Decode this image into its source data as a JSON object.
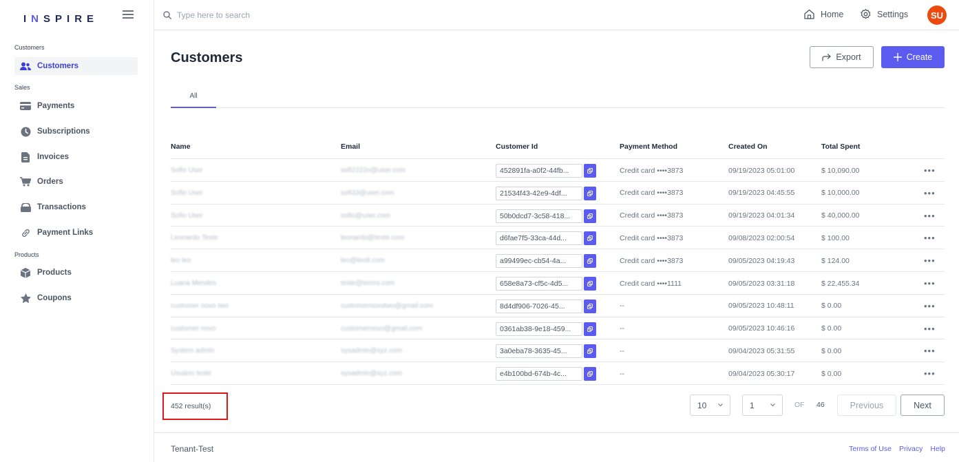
{
  "brand": {
    "prefix": "I",
    "accent": "N",
    "rest": "SPIRE"
  },
  "search": {
    "placeholder": "Type here to search"
  },
  "topnav": {
    "home": "Home",
    "settings": "Settings",
    "avatar": "SU"
  },
  "sidebar": {
    "sections": {
      "customers": "Customers",
      "sales": "Sales",
      "products": "Products"
    },
    "items": [
      {
        "label": "Customers",
        "icon": "users-icon",
        "active": true
      },
      {
        "label": "Payments",
        "icon": "credit-card-icon"
      },
      {
        "label": "Subscriptions",
        "icon": "clock-icon"
      },
      {
        "label": "Invoices",
        "icon": "document-icon"
      },
      {
        "label": "Orders",
        "icon": "cart-icon"
      },
      {
        "label": "Transactions",
        "icon": "stack-icon"
      },
      {
        "label": "Payment Links",
        "icon": "link-icon"
      },
      {
        "label": "Products",
        "icon": "box-icon"
      },
      {
        "label": "Coupons",
        "icon": "star-icon"
      }
    ]
  },
  "page": {
    "title": "Customers",
    "export_label": "Export",
    "create_label": "Create",
    "tab_all": "All"
  },
  "table": {
    "headers": [
      "Name",
      "Email",
      "Customer Id",
      "Payment Method",
      "Created On",
      "Total Spent"
    ],
    "rows": [
      {
        "name": "Sofio User",
        "email": "sofi2222o@user.com",
        "id": "452891fa-a0f2-44fb...",
        "method": "Credit card ••••3873",
        "created": "09/19/2023 05:01:00",
        "spent": "$ 10,090.00"
      },
      {
        "name": "Sofio User",
        "email": "sofi33@user.com",
        "id": "21534f43-42e9-4df...",
        "method": "Credit card ••••3873",
        "created": "09/19/2023 04:45:55",
        "spent": "$ 10,000.00"
      },
      {
        "name": "Sofio User",
        "email": "sofio@user.com",
        "id": "50b0dcd7-3c58-418...",
        "method": "Credit card ••••3873",
        "created": "09/19/2023 04:01:34",
        "spent": "$ 40,000.00"
      },
      {
        "name": "Leonardo Teste",
        "email": "leonardo@teste.com",
        "id": "d6fae7f5-33ca-44d...",
        "method": "Credit card ••••3873",
        "created": "09/08/2023 02:00:54",
        "spent": "$ 100.00"
      },
      {
        "name": "leo leo",
        "email": "leo@leo8.com",
        "id": "a99499ec-cb54-4a...",
        "method": "Credit card ••••3873",
        "created": "09/05/2023 04:19:43",
        "spent": "$ 124.00"
      },
      {
        "name": "Luana Mendes",
        "email": "teste@terms.com",
        "id": "658e8a73-cf5c-4d5...",
        "method": "Credit card ••••1111",
        "created": "09/05/2023 03:31:18",
        "spent": "$ 22,455.34"
      },
      {
        "name": "customer novo two",
        "email": "customernovotwo@gmail.com",
        "id": "8d4df906-7026-45...",
        "method": "--",
        "created": "09/05/2023 10:48:11",
        "spent": "$ 0.00"
      },
      {
        "name": "customer novo",
        "email": "customernovo@gmail.com",
        "id": "0361ab38-9e18-459...",
        "method": "--",
        "created": "09/05/2023 10:46:16",
        "spent": "$ 0.00"
      },
      {
        "name": "System admin",
        "email": "sysadmin@xyz.com",
        "id": "3a0eba78-3635-45...",
        "method": "--",
        "created": "09/04/2023 05:31:55",
        "spent": "$ 0.00"
      },
      {
        "name": "Usuário teste",
        "email": "sysadmin@xyz.com",
        "id": "e4b100bd-674b-4c...",
        "method": "--",
        "created": "09/04/2023 05:30:17",
        "spent": "$ 0.00"
      }
    ]
  },
  "pagination": {
    "results": "452 result(s)",
    "page_size": "10",
    "page": "1",
    "of": "OF",
    "total_pages": "46",
    "prev": "Previous",
    "next": "Next"
  },
  "footer": {
    "tenant": "Tenant-Test",
    "links": [
      "Terms of Use",
      "Privacy",
      "Help"
    ]
  },
  "colors": {
    "accent": "#5b5bf0",
    "avatar": "#ee4a0f",
    "highlight": "#e01616"
  }
}
